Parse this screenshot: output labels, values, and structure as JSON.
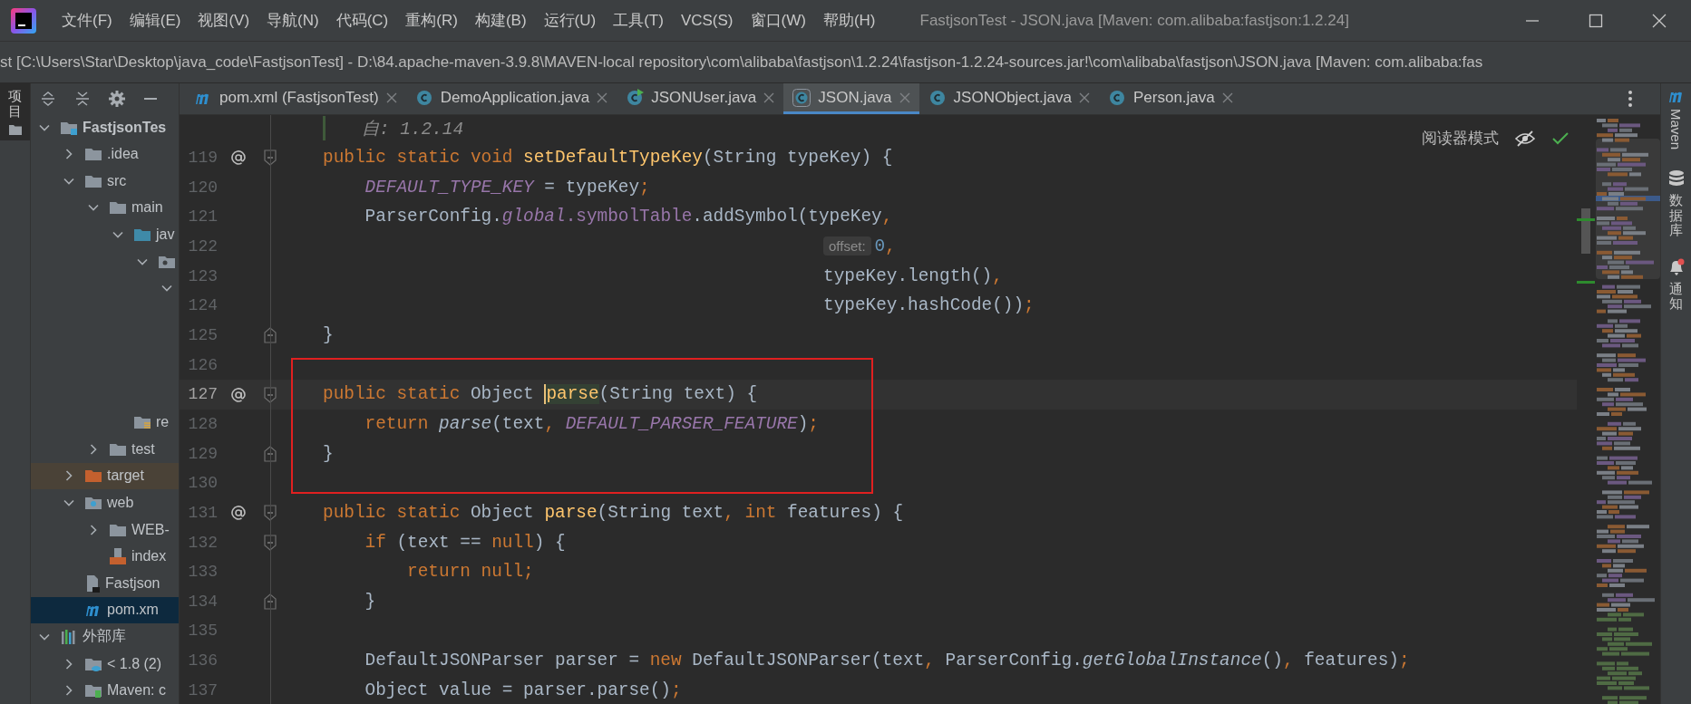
{
  "window": {
    "title": "FastjsonTest - JSON.java [Maven: com.alibaba:fastjson:1.2.24]"
  },
  "menu": [
    "文件(F)",
    "编辑(E)",
    "视图(V)",
    "导航(N)",
    "代码(C)",
    "重构(R)",
    "构建(B)",
    "运行(U)",
    "工具(T)",
    "VCS(S)",
    "窗口(W)",
    "帮助(H)"
  ],
  "path": "st [C:\\Users\\Star\\Desktop\\java_code\\FastjsonTest] - D:\\84.apache-maven-3.9.8\\MAVEN-local repository\\com\\alibaba\\fastjson\\1.2.24\\fastjson-1.2.24-sources.jar!\\com\\alibaba\\fastjson\\JSON.java [Maven: com.alibaba:fas",
  "left_stripe": {
    "label": "项目"
  },
  "project_tree": [
    {
      "label": "FastjsonTes",
      "kind": "module",
      "selected": false,
      "expanded": true,
      "children": [
        {
          "label": ".idea",
          "kind": "folder",
          "selected": false,
          "expanded": false
        },
        {
          "label": "src",
          "kind": "folder",
          "selected": false,
          "expanded": true,
          "children": [
            {
              "label": "main",
              "kind": "folder",
              "selected": false,
              "expanded": true,
              "children": [
                {
                  "label": "jav",
                  "kind": "source-folder",
                  "selected": false,
                  "expanded": true,
                  "children": [
                    {
                      "kind": "package",
                      "selected": false,
                      "expanded": true,
                      "children": [
                        {
                          "selected": false,
                          "expanded": true,
                          "children": [
                            {
                              "selected": false
                            },
                            {
                              "selected": false
                            },
                            {
                              "selected": false
                            },
                            {
                              "selected": false
                            }
                          ]
                        }
                      ]
                    }
                  ]
                },
                {
                  "label": "re",
                  "kind": "resources",
                  "selected": false
                }
              ]
            },
            {
              "label": "test",
              "kind": "folder",
              "selected": false,
              "expanded": false
            }
          ]
        },
        {
          "label": "target",
          "kind": "excluded-folder",
          "selected": false,
          "expanded": false
        },
        {
          "label": "web",
          "kind": "web-folder",
          "selected": false,
          "expanded": true,
          "children": [
            {
              "label": "WEB-",
              "kind": "folder",
              "selected": false,
              "expanded": false
            },
            {
              "label": "index",
              "kind": "jsp",
              "selected": false
            }
          ]
        },
        {
          "label": "Fastjson",
          "kind": "file",
          "selected": false
        },
        {
          "label": "pom.xm",
          "kind": "maven",
          "selected": true
        }
      ]
    },
    {
      "label": "外部库",
      "kind": "library",
      "selected": false,
      "expanded": true,
      "children": [
        {
          "label": "< 1.8 (2)",
          "kind": "jdk",
          "selected": false,
          "expanded": false
        },
        {
          "label": "Maven: c",
          "kind": "jar",
          "selected": false,
          "expanded": false
        }
      ]
    }
  ],
  "tabs": [
    {
      "label": "pom.xml (FastjsonTest)",
      "kind": "maven",
      "selected": false
    },
    {
      "label": "DemoApplication.java",
      "kind": "class",
      "selected": false
    },
    {
      "label": "JSONUser.java",
      "kind": "runnable-class",
      "selected": false
    },
    {
      "label": "JSON.java",
      "kind": "library-class",
      "selected": true
    },
    {
      "label": "JSONObject.java",
      "kind": "class",
      "selected": false
    },
    {
      "label": "Person.java",
      "kind": "class",
      "selected": false
    }
  ],
  "editor": {
    "reader_mode": "阅读器模式",
    "lines": [
      {
        "kind": "doc",
        "tokens": [
          {
            "text": "自: 1.2.14",
            "kind": "doc"
          }
        ]
      },
      {
        "kind": "code",
        "number": "119",
        "annotation": true,
        "fold_start": true,
        "current": false,
        "tokens": [
          {
            "text": "public static void ",
            "kind": "kw"
          },
          {
            "text": "setDefaultTypeKey",
            "kind": "fn"
          },
          {
            "text": "(String typeKey) {",
            "kind": "plain"
          }
        ]
      },
      {
        "kind": "code",
        "number": "120",
        "annotation": false,
        "current": false,
        "tokens": [
          {
            "text": "    DEFAULT_TYPE_KEY",
            "kind": "const"
          },
          {
            "text": " = typeKey",
            "kind": "plain"
          },
          {
            "text": ";",
            "kind": "kw"
          }
        ]
      },
      {
        "kind": "code",
        "number": "121",
        "annotation": false,
        "current": false,
        "tokens": [
          {
            "text": "    ParserConfig.",
            "kind": "plain"
          },
          {
            "text": "global",
            "kind": "const"
          },
          {
            "text": ".symbolTable",
            "kind": "field"
          },
          {
            "text": ".addSymbol(typeKey",
            "kind": "plain"
          },
          {
            "text": ",",
            "kind": "kw"
          }
        ]
      },
      {
        "kind": "continuation",
        "number": "122",
        "annotation": false,
        "current": false,
        "tokens": [
          {
            "text": "offset:",
            "kind": "hint"
          },
          {
            "text": "0",
            "kind": "num"
          },
          {
            "text": ",",
            "kind": "kw"
          }
        ]
      },
      {
        "kind": "continuation",
        "number": "123",
        "annotation": false,
        "current": false,
        "tokens": [
          {
            "text": "typeKey.length()",
            "kind": "plain"
          },
          {
            "text": ",",
            "kind": "kw"
          }
        ]
      },
      {
        "kind": "continuation",
        "number": "124",
        "annotation": false,
        "current": false,
        "tokens": [
          {
            "text": "typeKey.hashCode())",
            "kind": "plain"
          },
          {
            "text": ";",
            "kind": "kw"
          }
        ]
      },
      {
        "kind": "code",
        "number": "125",
        "annotation": false,
        "fold_end": true,
        "current": false,
        "tokens": [
          {
            "text": "}",
            "kind": "plain"
          }
        ]
      },
      {
        "number": "126",
        "annotation": false,
        "current": false
      },
      {
        "kind": "code",
        "number": "127",
        "annotation": true,
        "fold_start": true,
        "current": true,
        "tokens": [
          {
            "text": "public static ",
            "kind": "kw"
          },
          {
            "text": "Object ",
            "kind": "plain"
          },
          {
            "text": "parse",
            "kind": "fn-match"
          },
          {
            "text": "(String text) {",
            "kind": "plain"
          }
        ]
      },
      {
        "kind": "code",
        "number": "128",
        "annotation": false,
        "current": false,
        "tokens": [
          {
            "text": "    return ",
            "kind": "kw"
          },
          {
            "text": "parse",
            "kind": "call"
          },
          {
            "text": "(text",
            "kind": "plain"
          },
          {
            "text": ", ",
            "kind": "kw"
          },
          {
            "text": "DEFAULT_PARSER_FEATURE",
            "kind": "const"
          },
          {
            "text": ")",
            "kind": "plain"
          },
          {
            "text": ";",
            "kind": "kw"
          }
        ]
      },
      {
        "kind": "code",
        "number": "129",
        "annotation": false,
        "fold_end": true,
        "current": false,
        "tokens": [
          {
            "text": "}",
            "kind": "plain"
          }
        ]
      },
      {
        "number": "130",
        "annotation": false,
        "current": false
      },
      {
        "kind": "code",
        "number": "131",
        "annotation": true,
        "fold_start": true,
        "current": false,
        "tokens": [
          {
            "text": "public static ",
            "kind": "kw"
          },
          {
            "text": "Object ",
            "kind": "plain"
          },
          {
            "text": "parse",
            "kind": "fn"
          },
          {
            "text": "(String text",
            "kind": "plain"
          },
          {
            "text": ", int ",
            "kind": "kw"
          },
          {
            "text": "features) {",
            "kind": "plain"
          }
        ]
      },
      {
        "kind": "code",
        "number": "132",
        "annotation": false,
        "fold_start": true,
        "current": false,
        "tokens": [
          {
            "text": "    if ",
            "kind": "kw"
          },
          {
            "text": "(text == ",
            "kind": "plain"
          },
          {
            "text": "null",
            "kind": "kw"
          },
          {
            "text": ") {",
            "kind": "plain"
          }
        ]
      },
      {
        "kind": "code",
        "number": "133",
        "annotation": false,
        "current": false,
        "tokens": [
          {
            "text": "        return null;",
            "kind": "kw"
          }
        ]
      },
      {
        "kind": "code",
        "number": "134",
        "annotation": false,
        "fold_end": true,
        "current": false,
        "tokens": [
          {
            "text": "    }",
            "kind": "plain"
          }
        ]
      },
      {
        "number": "135",
        "annotation": false,
        "current": false
      },
      {
        "kind": "code",
        "number": "136",
        "annotation": false,
        "current": false,
        "tokens": [
          {
            "text": "    DefaultJSONParser parser = ",
            "kind": "plain"
          },
          {
            "text": "new ",
            "kind": "kw"
          },
          {
            "text": "DefaultJSONParser(text",
            "kind": "plain"
          },
          {
            "text": ", ",
            "kind": "kw"
          },
          {
            "text": "ParserConfig.",
            "kind": "plain"
          },
          {
            "text": "getGlobalInstance",
            "kind": "call"
          },
          {
            "text": "()",
            "kind": "plain"
          },
          {
            "text": ", ",
            "kind": "kw"
          },
          {
            "text": "features)",
            "kind": "plain"
          },
          {
            "text": ";",
            "kind": "kw"
          }
        ]
      },
      {
        "kind": "code",
        "number": "137",
        "annotation": false,
        "current": false,
        "tokens": [
          {
            "text": "    Object value = parser.parse()",
            "kind": "plain"
          },
          {
            "text": ";",
            "kind": "kw"
          }
        ]
      }
    ]
  },
  "right_stripe": [
    {
      "label": "Maven",
      "kind": "maven"
    },
    {
      "label": "数据库",
      "kind": "database"
    },
    {
      "label": "通知",
      "kind": "notifications"
    }
  ]
}
